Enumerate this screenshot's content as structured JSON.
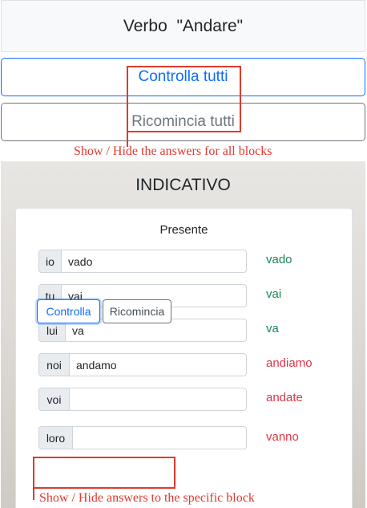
{
  "header": {
    "title": "Verbo  \"Andare\""
  },
  "global_actions": {
    "check_all_label": "Controlla tutti",
    "reset_all_label": "Ricomincia tutti"
  },
  "annotations": {
    "global_note": "Show / Hide the answers for all blocks",
    "block_note": "Show / Hide answers to the specific block"
  },
  "section": {
    "title": "INDICATIVO"
  },
  "block": {
    "title": "Presente",
    "rows": [
      {
        "pronoun": "io",
        "value": "vado",
        "answer": "vado",
        "status": "correct"
      },
      {
        "pronoun": "tu",
        "value": "vai",
        "answer": "vai",
        "status": "correct"
      },
      {
        "pronoun": "lui",
        "value": "va",
        "answer": "va",
        "status": "correct"
      },
      {
        "pronoun": "noi",
        "value": "andamo",
        "answer": "andiamo",
        "status": "wrong"
      },
      {
        "pronoun": "voi",
        "value": "",
        "answer": "andate",
        "status": "wrong"
      },
      {
        "pronoun": "loro",
        "value": "",
        "answer": "vanno",
        "status": "wrong"
      }
    ],
    "check_label": "Controlla",
    "reset_label": "Ricomincia"
  },
  "colors": {
    "correct": "#198754",
    "wrong": "#dc3545",
    "primary": "#0d6efd",
    "annotation": "#e03a2f"
  }
}
